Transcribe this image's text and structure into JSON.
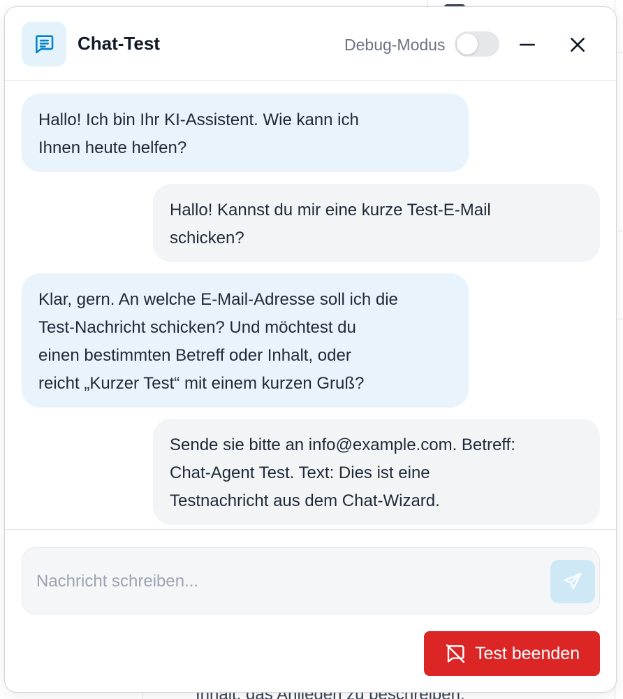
{
  "header": {
    "title": "Chat-Test",
    "debug_label": "Debug-Modus",
    "debug_enabled": false
  },
  "messages": [
    {
      "role": "assistant",
      "text": "Hallo! Ich bin Ihr KI-Assistent. Wie kann ich\nIhnen heute helfen?"
    },
    {
      "role": "user",
      "text": "Hallo! Kannst du mir eine kurze Test-E-Mail\nschicken?"
    },
    {
      "role": "assistant",
      "text": "Klar, gern. An welche E-Mail-Adresse soll ich die\nTest-Nachricht schicken? Und möchtest du\neinen bestimmten Betreff oder Inhalt, oder\nreicht „Kurzer Test“ mit einem kurzen Gruß?"
    },
    {
      "role": "user",
      "text": "Sende sie bitte an info@example.com. Betreff:\nChat-Agent Test. Text: Dies ist eine\nTestnachricht aus dem Chat-Wizard."
    }
  ],
  "composer": {
    "placeholder": "Nachricht schreiben...",
    "value": ""
  },
  "actions": {
    "end_test_label": "Test beenden"
  },
  "background": {
    "bottom_text": "Inhalt, das Anliegen zu beschreiben."
  },
  "colors": {
    "accent": "#0284c7",
    "bot_bubble": "#e8f3fb",
    "user_bubble": "#f3f4f6",
    "danger": "#dc2626"
  },
  "icons": {
    "header": "chat-message-icon",
    "minimize": "minus-icon",
    "close": "close-icon",
    "send": "send-icon",
    "end_test": "message-off-icon"
  }
}
